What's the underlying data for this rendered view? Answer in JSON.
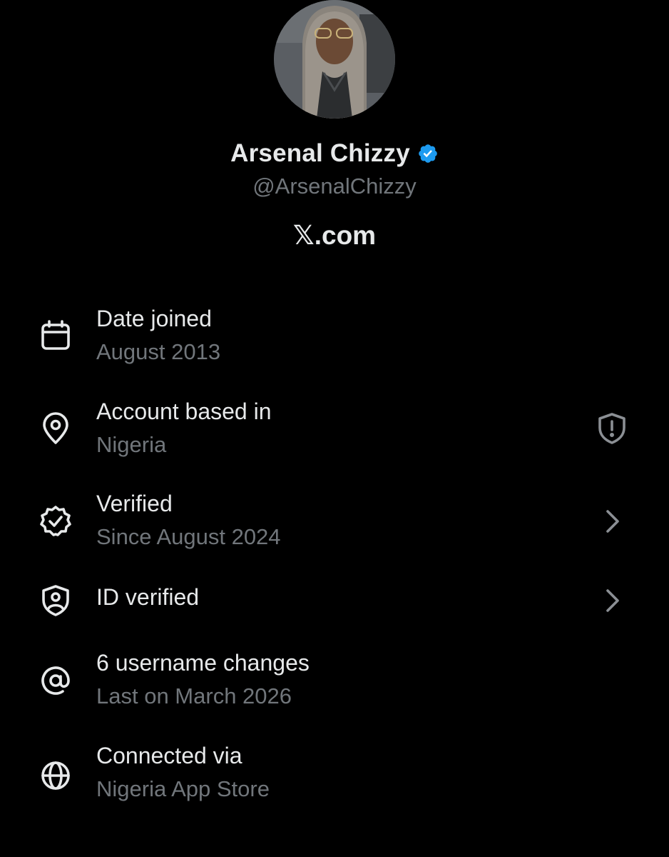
{
  "profile": {
    "display_name": "Arsenal Chizzy",
    "handle": "@ArsenalChizzy",
    "site": "𝕏.com",
    "verified_badge_icon": "verified-check-icon",
    "verified_color": "#1d9bf0"
  },
  "about": {
    "date_joined": {
      "icon": "calendar-icon",
      "title": "Date joined",
      "subtitle": "August 2013"
    },
    "based_in": {
      "icon": "location-pin-icon",
      "title": "Account based in",
      "subtitle": "Nigeria",
      "trailing_icon": "shield-alert-icon"
    },
    "verified": {
      "icon": "verified-badge-outline-icon",
      "title": "Verified",
      "subtitle": "Since August 2024",
      "trailing_icon": "chevron-right-icon"
    },
    "id_verified": {
      "icon": "shield-person-icon",
      "title": "ID verified",
      "trailing_icon": "chevron-right-icon"
    },
    "username_changes": {
      "icon": "at-sign-icon",
      "title": "6 username changes",
      "subtitle": "Last on March 2026"
    },
    "connected_via": {
      "icon": "globe-icon",
      "title": "Connected via",
      "subtitle": "Nigeria App Store"
    }
  },
  "colors": {
    "background": "#000000",
    "primary_text": "#e7e9ea",
    "secondary_text": "#71767b"
  }
}
